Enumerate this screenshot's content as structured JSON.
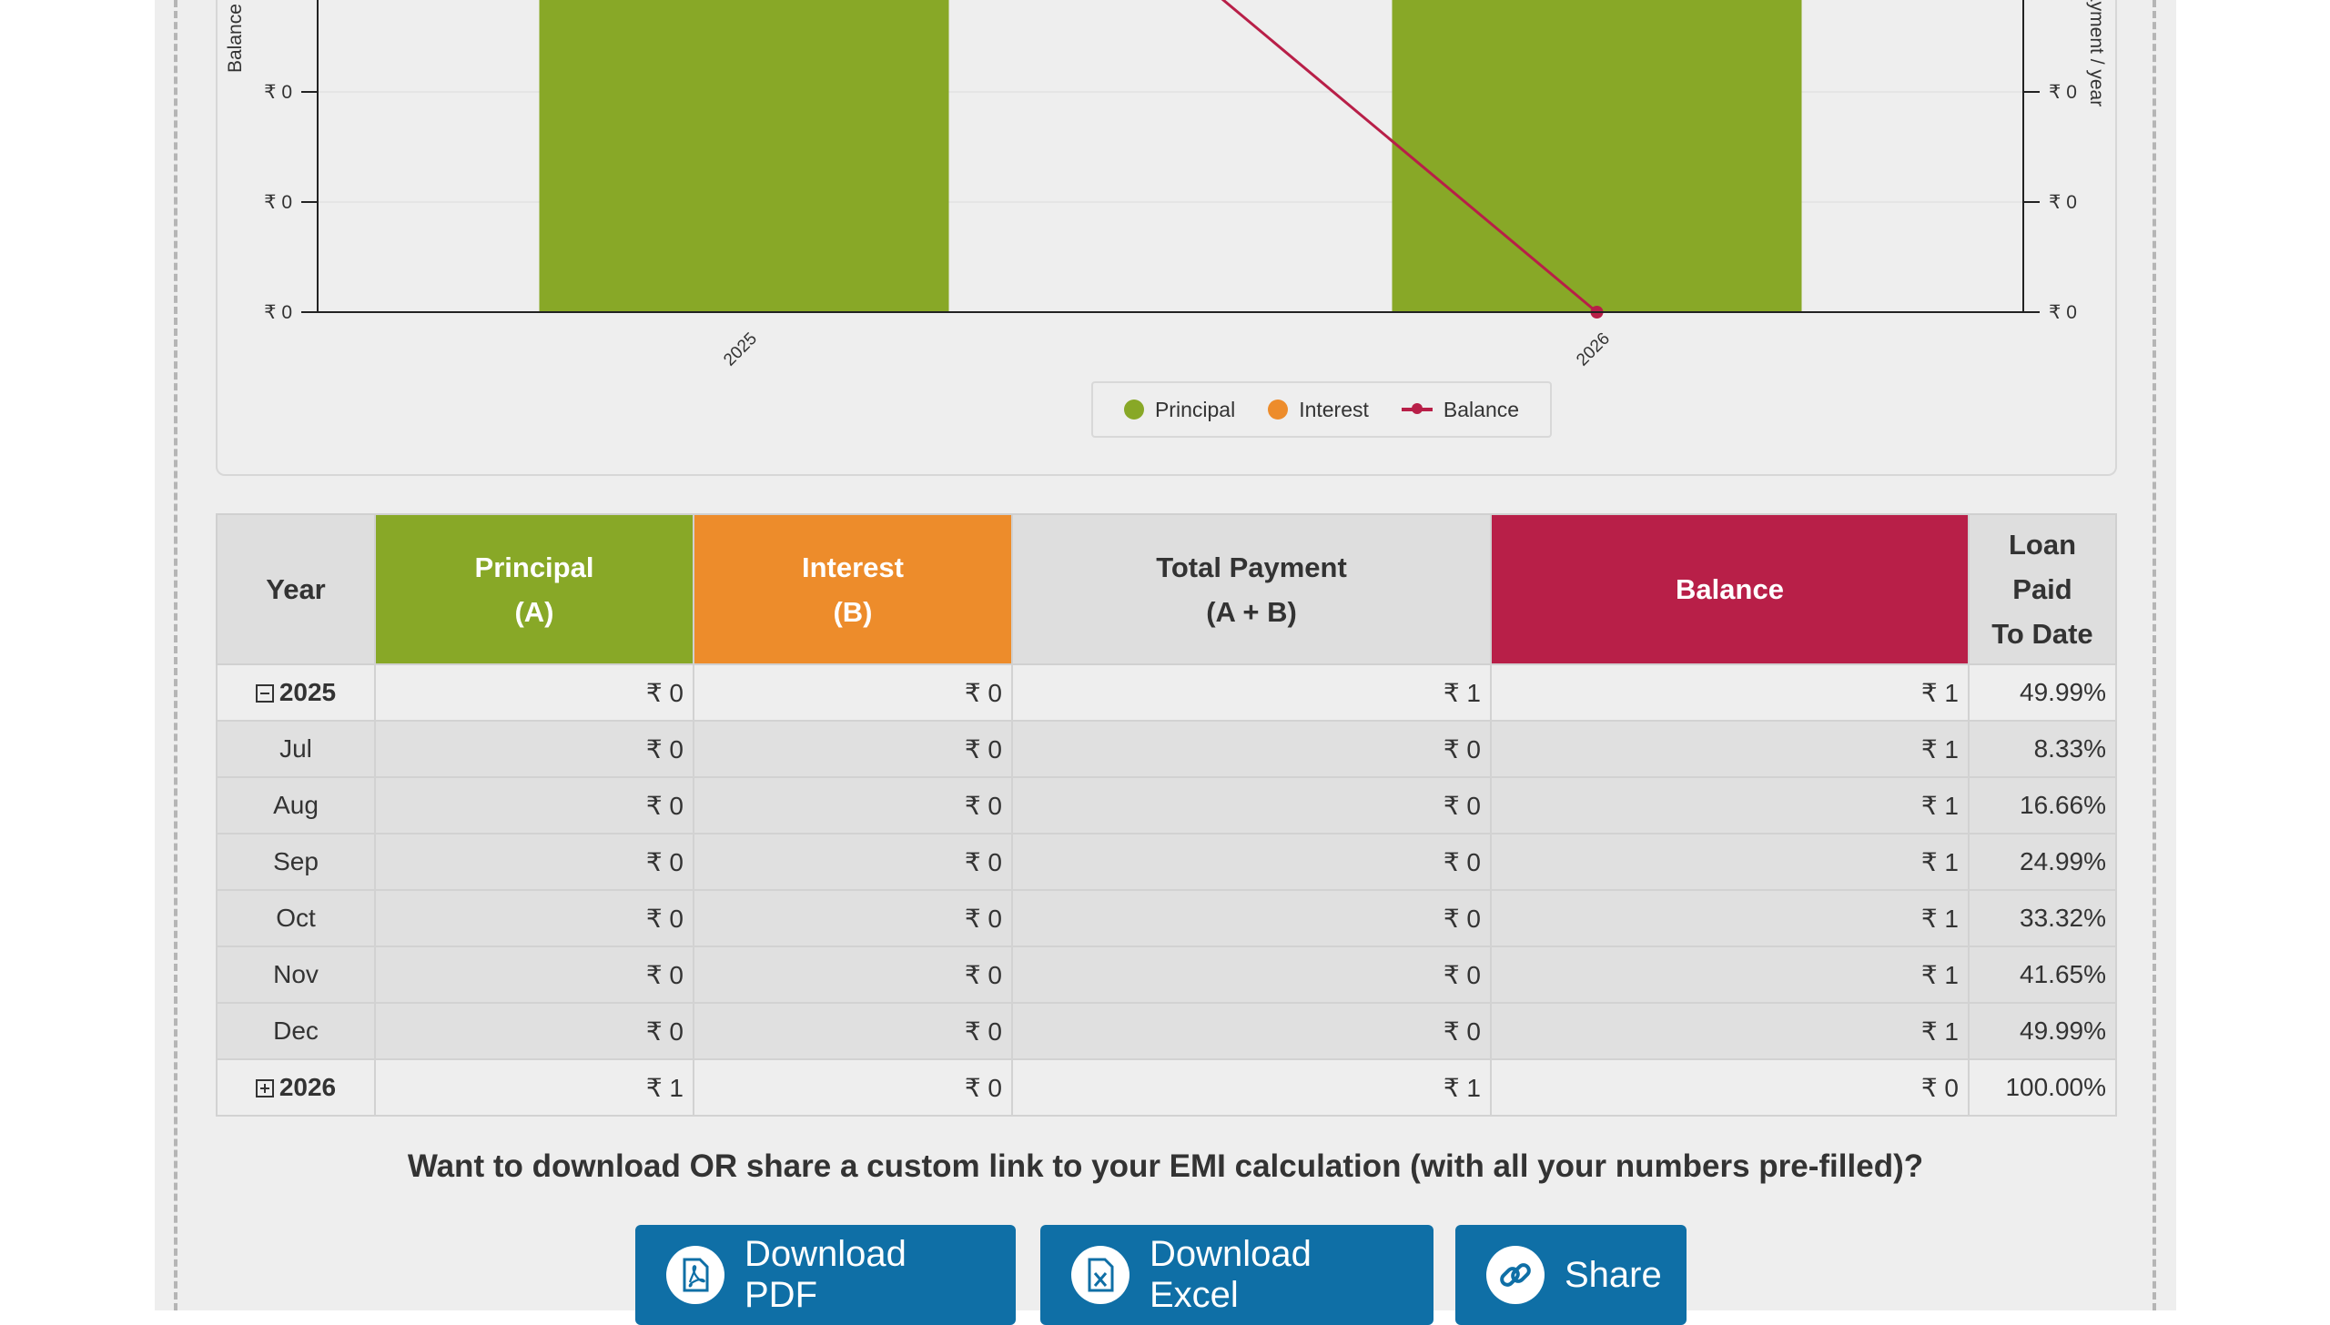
{
  "chart_data": {
    "type": "bar",
    "categories": [
      "2025",
      "2026"
    ],
    "series": [
      {
        "name": "Principal",
        "type": "bar",
        "axis": "right",
        "values": [
          0,
          1
        ],
        "color": "#88a827"
      },
      {
        "name": "Interest",
        "type": "bar",
        "axis": "right",
        "values": [
          0,
          0
        ],
        "color": "#ed8c2b"
      },
      {
        "name": "Balance",
        "type": "line",
        "axis": "left",
        "values": [
          1,
          0
        ],
        "color": "#b81f48"
      }
    ],
    "ylabel": "Balance",
    "ylabel_right": "ayment / year",
    "left_ticks": [
      "₹ 0",
      "₹ 0",
      "₹ 0"
    ],
    "right_ticks": [
      "₹ 0",
      "₹ 0",
      "₹ 0"
    ],
    "legend": [
      "Principal",
      "Interest",
      "Balance"
    ],
    "legend_position": "bottom-center",
    "grid": true
  },
  "table": {
    "headers": {
      "year": "Year",
      "principal_1": "Principal",
      "principal_2": "(A)",
      "interest_1": "Interest",
      "interest_2": "(B)",
      "total_1": "Total Payment",
      "total_2": "(A + B)",
      "balance": "Balance",
      "paid_1": "Loan Paid",
      "paid_2": "To Date"
    },
    "rows": [
      {
        "year": "2025",
        "principal": "₹ 0",
        "interest": "₹ 0",
        "total": "₹ 1",
        "balance": "₹ 1",
        "paid": "49.99%"
      },
      {
        "year": "Jul",
        "principal": "₹ 0",
        "interest": "₹ 0",
        "total": "₹ 0",
        "balance": "₹ 1",
        "paid": "8.33%"
      },
      {
        "year": "Aug",
        "principal": "₹ 0",
        "interest": "₹ 0",
        "total": "₹ 0",
        "balance": "₹ 1",
        "paid": "16.66%"
      },
      {
        "year": "Sep",
        "principal": "₹ 0",
        "interest": "₹ 0",
        "total": "₹ 0",
        "balance": "₹ 1",
        "paid": "24.99%"
      },
      {
        "year": "Oct",
        "principal": "₹ 0",
        "interest": "₹ 0",
        "total": "₹ 0",
        "balance": "₹ 1",
        "paid": "33.32%"
      },
      {
        "year": "Nov",
        "principal": "₹ 0",
        "interest": "₹ 0",
        "total": "₹ 0",
        "balance": "₹ 1",
        "paid": "41.65%"
      },
      {
        "year": "Dec",
        "principal": "₹ 0",
        "interest": "₹ 0",
        "total": "₹ 0",
        "balance": "₹ 1",
        "paid": "49.99%"
      },
      {
        "year": "2026",
        "principal": "₹ 1",
        "interest": "₹ 0",
        "total": "₹ 1",
        "balance": "₹ 0",
        "paid": "100.00%"
      }
    ]
  },
  "download": {
    "prompt": "Want to download OR share a custom link to your EMI calculation (with all your numbers pre-filled)?",
    "pdf_label": "Download PDF",
    "excel_label": "Download Excel",
    "share_label": "Share",
    "pdf_icon": "pdf-icon",
    "excel_icon": "excel-icon",
    "share_icon": "link-icon"
  },
  "colors": {
    "principal": "#88a827",
    "interest": "#ed8c2b",
    "balance": "#b81f48",
    "button": "#0f6fa6"
  }
}
